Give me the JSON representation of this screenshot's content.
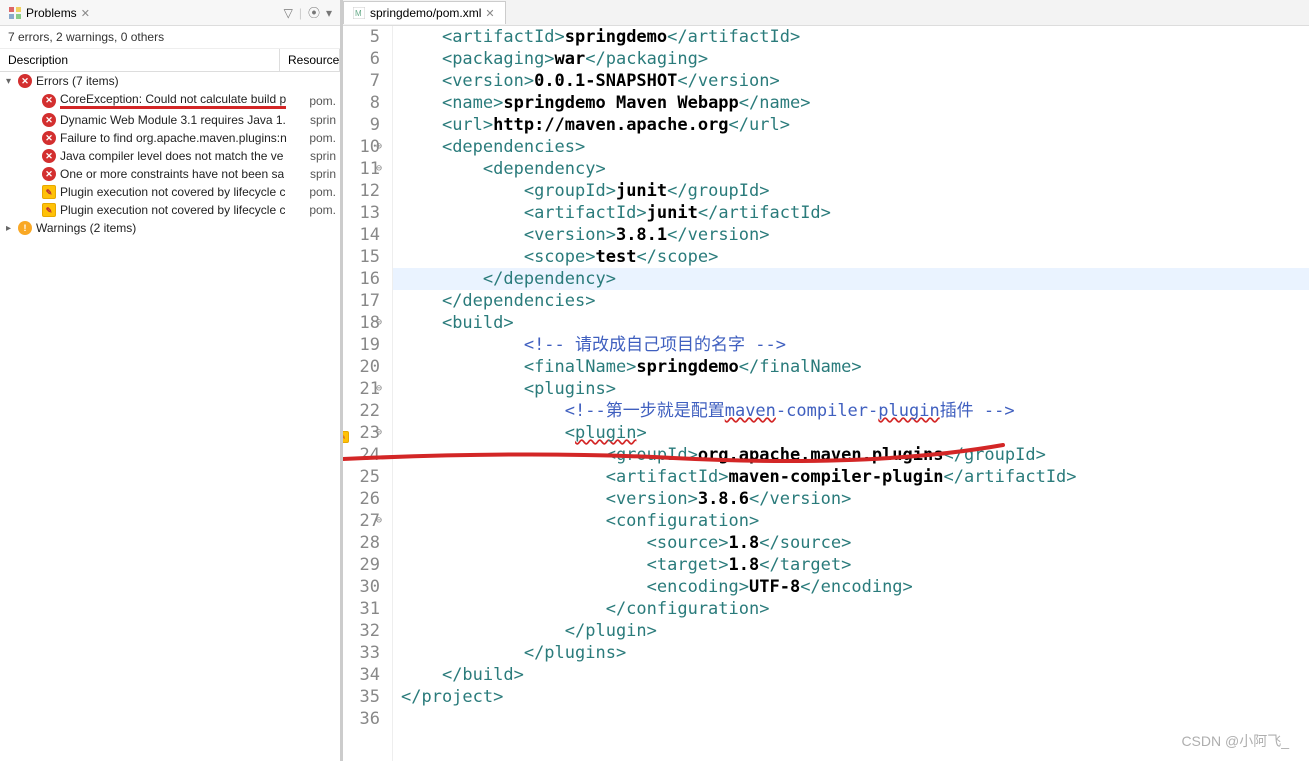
{
  "problems_panel": {
    "tab_title": "Problems",
    "summary": "7 errors, 2 warnings, 0 others",
    "columns": {
      "description": "Description",
      "resource": "Resource"
    },
    "groups": [
      {
        "label": "Errors (7 items)",
        "kind": "error",
        "expanded": true,
        "items": [
          {
            "label": "CoreException: Could not calculate build p",
            "resource": "pom.",
            "kind": "error",
            "underline": true
          },
          {
            "label": "Dynamic Web Module 3.1 requires Java 1.",
            "resource": "sprin",
            "kind": "error"
          },
          {
            "label": "Failure to find org.apache.maven.plugins:n",
            "resource": "pom.",
            "kind": "error"
          },
          {
            "label": "Java compiler level does not match the ve",
            "resource": "sprin",
            "kind": "error"
          },
          {
            "label": "One or more constraints have not been sa",
            "resource": "sprin",
            "kind": "error"
          },
          {
            "label": "Plugin execution not covered by lifecycle c",
            "resource": "pom.",
            "kind": "quickfix"
          },
          {
            "label": "Plugin execution not covered by lifecycle c",
            "resource": "pom.",
            "kind": "quickfix"
          }
        ]
      },
      {
        "label": "Warnings (2 items)",
        "kind": "warn",
        "expanded": false,
        "items": []
      }
    ]
  },
  "editor": {
    "tab_title": "springdemo/pom.xml",
    "lines": [
      {
        "n": 5,
        "tokens": [
          [
            "\t",
            "pad"
          ],
          [
            "<artifactId>",
            "tag"
          ],
          [
            "springdemo",
            "txt"
          ],
          [
            "</artifactId>",
            "tag"
          ]
        ]
      },
      {
        "n": 6,
        "tokens": [
          [
            "\t",
            "pad"
          ],
          [
            "<packaging>",
            "tag"
          ],
          [
            "war",
            "txt"
          ],
          [
            "</packaging>",
            "tag"
          ]
        ]
      },
      {
        "n": 7,
        "tokens": [
          [
            "\t",
            "pad"
          ],
          [
            "<version>",
            "tag"
          ],
          [
            "0.0.1-SNAPSHOT",
            "txt"
          ],
          [
            "</version>",
            "tag"
          ]
        ]
      },
      {
        "n": 8,
        "tokens": [
          [
            "\t",
            "pad"
          ],
          [
            "<name>",
            "tag"
          ],
          [
            "springdemo Maven Webapp",
            "txt"
          ],
          [
            "</name>",
            "tag"
          ]
        ]
      },
      {
        "n": 9,
        "tokens": [
          [
            "\t",
            "pad"
          ],
          [
            "<url>",
            "tag"
          ],
          [
            "http://maven.apache.org",
            "txt"
          ],
          [
            "</url>",
            "tag"
          ]
        ]
      },
      {
        "n": 10,
        "fold": true,
        "tokens": [
          [
            "\t",
            "pad"
          ],
          [
            "<dependencies>",
            "tag"
          ]
        ]
      },
      {
        "n": 11,
        "fold": true,
        "tokens": [
          [
            "\t\t",
            "pad"
          ],
          [
            "<dependency>",
            "tag"
          ]
        ]
      },
      {
        "n": 12,
        "tokens": [
          [
            "\t\t\t",
            "pad"
          ],
          [
            "<groupId>",
            "tag"
          ],
          [
            "junit",
            "txt"
          ],
          [
            "</groupId>",
            "tag"
          ]
        ]
      },
      {
        "n": 13,
        "tokens": [
          [
            "\t\t\t",
            "pad"
          ],
          [
            "<artifactId>",
            "tag"
          ],
          [
            "junit",
            "txt"
          ],
          [
            "</artifactId>",
            "tag"
          ]
        ]
      },
      {
        "n": 14,
        "tokens": [
          [
            "\t\t\t",
            "pad"
          ],
          [
            "<version>",
            "tag"
          ],
          [
            "3.8.1",
            "txt"
          ],
          [
            "</version>",
            "tag"
          ]
        ]
      },
      {
        "n": 15,
        "tokens": [
          [
            "\t\t\t",
            "pad"
          ],
          [
            "<scope>",
            "tag"
          ],
          [
            "test",
            "txt"
          ],
          [
            "</scope>",
            "tag"
          ]
        ]
      },
      {
        "n": 16,
        "hl": true,
        "tokens": [
          [
            "\t\t",
            "pad"
          ],
          [
            "</dependency>",
            "tag"
          ]
        ]
      },
      {
        "n": 17,
        "tokens": [
          [
            "\t",
            "pad"
          ],
          [
            "</dependencies>",
            "tag"
          ]
        ]
      },
      {
        "n": 18,
        "fold": true,
        "tokens": [
          [
            "\t",
            "pad"
          ],
          [
            "<build>",
            "tag"
          ]
        ]
      },
      {
        "n": 19,
        "tokens": [
          [
            "\t\t\t",
            "pad"
          ],
          [
            "<!-- 请改成自己项目的名字 -->",
            "cmt"
          ]
        ]
      },
      {
        "n": 20,
        "tokens": [
          [
            "\t\t\t",
            "pad"
          ],
          [
            "<finalName>",
            "tag"
          ],
          [
            "springdemo",
            "txt"
          ],
          [
            "</finalName>",
            "tag"
          ]
        ]
      },
      {
        "n": 21,
        "fold": true,
        "tokens": [
          [
            "\t\t\t",
            "pad"
          ],
          [
            "<plugins>",
            "tag"
          ]
        ]
      },
      {
        "n": 22,
        "tokens": [
          [
            "\t\t\t\t",
            "pad"
          ],
          [
            "<!--第一步就是配置",
            "cmt"
          ],
          [
            "maven",
            "cmt-wavy"
          ],
          [
            "-compiler-",
            "cmt"
          ],
          [
            "plugin",
            "cmt-wavy"
          ],
          [
            "插件 -->",
            "cmt"
          ]
        ]
      },
      {
        "n": 23,
        "fold": true,
        "icon": "quickfix",
        "tokens": [
          [
            "\t\t\t\t",
            "pad"
          ],
          [
            "<",
            "tag"
          ],
          [
            "plugin",
            "tag-wavy"
          ],
          [
            ">",
            "tag"
          ]
        ]
      },
      {
        "n": 24,
        "tokens": [
          [
            "\t\t\t\t\t",
            "pad"
          ],
          [
            "<groupId>",
            "tag"
          ],
          [
            "org.apache.maven.plugins",
            "txt"
          ],
          [
            "</groupId>",
            "tag"
          ]
        ]
      },
      {
        "n": 25,
        "tokens": [
          [
            "\t\t\t\t\t",
            "pad"
          ],
          [
            "<artifactId>",
            "tag"
          ],
          [
            "maven-compiler-plugin",
            "txt"
          ],
          [
            "</artifactId>",
            "tag"
          ]
        ]
      },
      {
        "n": 26,
        "tokens": [
          [
            "\t\t\t\t\t",
            "pad"
          ],
          [
            "<version>",
            "tag"
          ],
          [
            "3.8.6",
            "txt"
          ],
          [
            "</version>",
            "tag"
          ]
        ]
      },
      {
        "n": 27,
        "fold": true,
        "tokens": [
          [
            "\t\t\t\t\t",
            "pad"
          ],
          [
            "<configuration>",
            "tag"
          ]
        ]
      },
      {
        "n": 28,
        "tokens": [
          [
            "\t\t\t\t\t\t",
            "pad"
          ],
          [
            "<source>",
            "tag"
          ],
          [
            "1.8",
            "txt"
          ],
          [
            "</source>",
            "tag"
          ]
        ]
      },
      {
        "n": 29,
        "tokens": [
          [
            "\t\t\t\t\t\t",
            "pad"
          ],
          [
            "<target>",
            "tag"
          ],
          [
            "1.8",
            "txt"
          ],
          [
            "</target>",
            "tag"
          ]
        ]
      },
      {
        "n": 30,
        "tokens": [
          [
            "\t\t\t\t\t\t",
            "pad"
          ],
          [
            "<encoding>",
            "tag"
          ],
          [
            "UTF-8",
            "txt"
          ],
          [
            "</encoding>",
            "tag"
          ]
        ]
      },
      {
        "n": 31,
        "tokens": [
          [
            "\t\t\t\t\t",
            "pad"
          ],
          [
            "</configuration>",
            "tag"
          ]
        ]
      },
      {
        "n": 32,
        "tokens": [
          [
            "\t\t\t\t",
            "pad"
          ],
          [
            "</plugin>",
            "tag"
          ]
        ]
      },
      {
        "n": 33,
        "tokens": [
          [
            "\t\t\t",
            "pad"
          ],
          [
            "</plugins>",
            "tag"
          ]
        ]
      },
      {
        "n": 34,
        "tokens": [
          [
            "\t",
            "pad"
          ],
          [
            "</build>",
            "tag"
          ]
        ]
      },
      {
        "n": 35,
        "tokens": [
          [
            "",
            "pad"
          ],
          [
            "</project>",
            "tag"
          ]
        ]
      },
      {
        "n": 36,
        "tokens": [
          [
            "",
            "pad"
          ]
        ]
      }
    ]
  },
  "watermark": "CSDN @小阿飞_"
}
